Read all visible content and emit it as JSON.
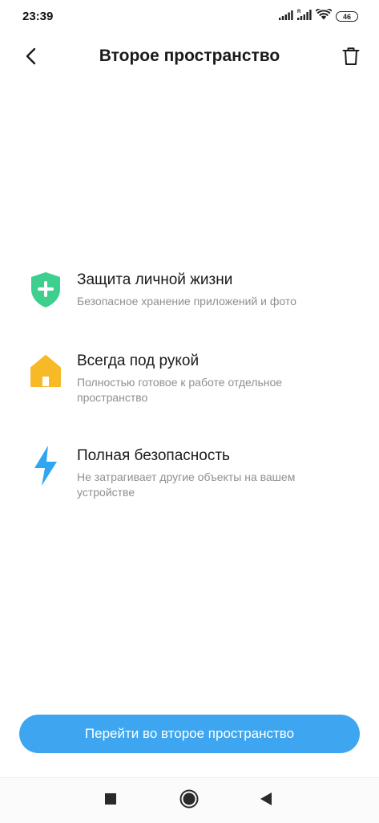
{
  "status_bar": {
    "time": "23:39",
    "battery_level": "46",
    "icons": [
      "signal-icon",
      "signal-icon",
      "wifi-icon",
      "battery-icon"
    ]
  },
  "header": {
    "title": "Второе пространство",
    "back_icon": "back-arrow-icon",
    "trash_icon": "trash-icon"
  },
  "features": [
    {
      "icon": "shield-plus-icon",
      "icon_color": "#3ccf8e",
      "title": "Защита личной жизни",
      "subtitle": "Безопасное хранение приложений и фото"
    },
    {
      "icon": "house-icon",
      "icon_color": "#f7b928",
      "title": "Всегда под рукой",
      "subtitle": "Полностью готовое к работе отдельное пространство"
    },
    {
      "icon": "lightning-icon",
      "icon_color": "#2ea6f2",
      "title": "Полная безопасность",
      "subtitle": "Не затрагивает другие объекты на вашем устройстве"
    }
  ],
  "primary_button": {
    "label": "Перейти во второе пространство",
    "color": "#3ea6f0"
  },
  "nav_bar": {
    "icons": [
      "recents-square-icon",
      "home-circle-icon",
      "back-triangle-icon"
    ]
  }
}
